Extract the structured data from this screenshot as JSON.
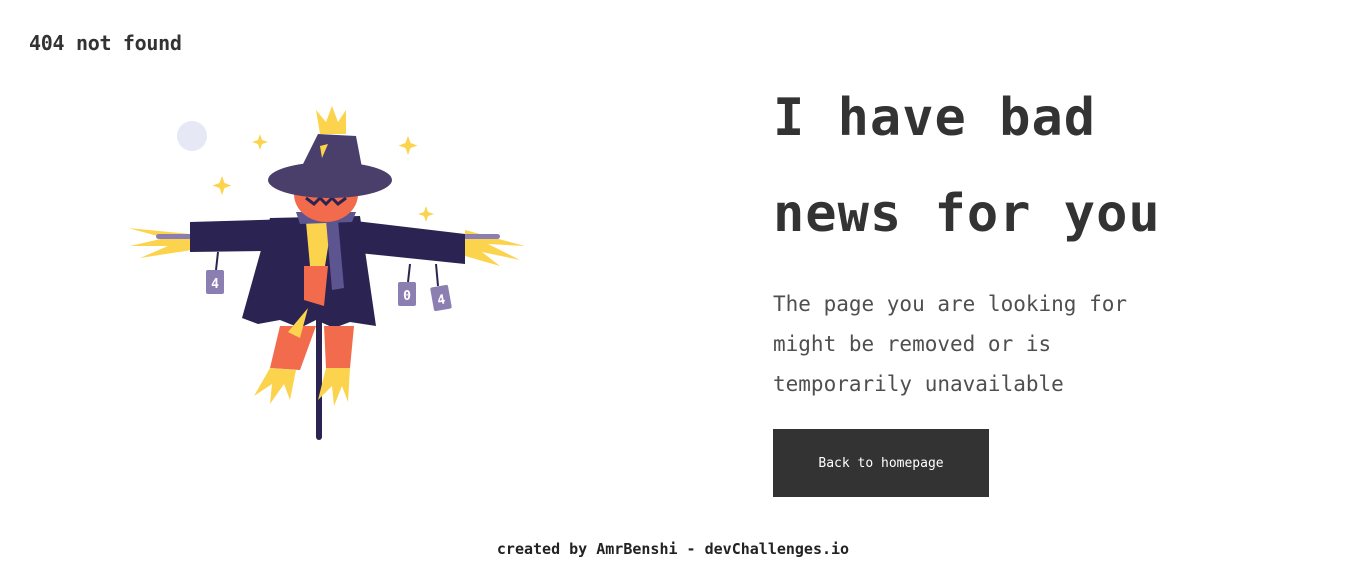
{
  "header": {
    "brand": "404 not found"
  },
  "main": {
    "headline_line1": "I have bad",
    "headline_line2": "news for you",
    "description": "The page you are looking for might be removed or is temporarily unavailable",
    "button_label": "Back to homepage"
  },
  "illustration": {
    "subject": "scarecrow",
    "tag_digits": [
      "4",
      "0",
      "4"
    ]
  },
  "footer": {
    "text": "created by AmrBenshi - devChallenges.io"
  },
  "colors": {
    "text": "#333333",
    "button_bg": "#333333",
    "button_text": "#ffffff",
    "hat": "#4a3f6b",
    "coat": "#2b2452",
    "face": "#f26b4c",
    "straw": "#fcd34d",
    "tag": "#8a7fb0"
  }
}
